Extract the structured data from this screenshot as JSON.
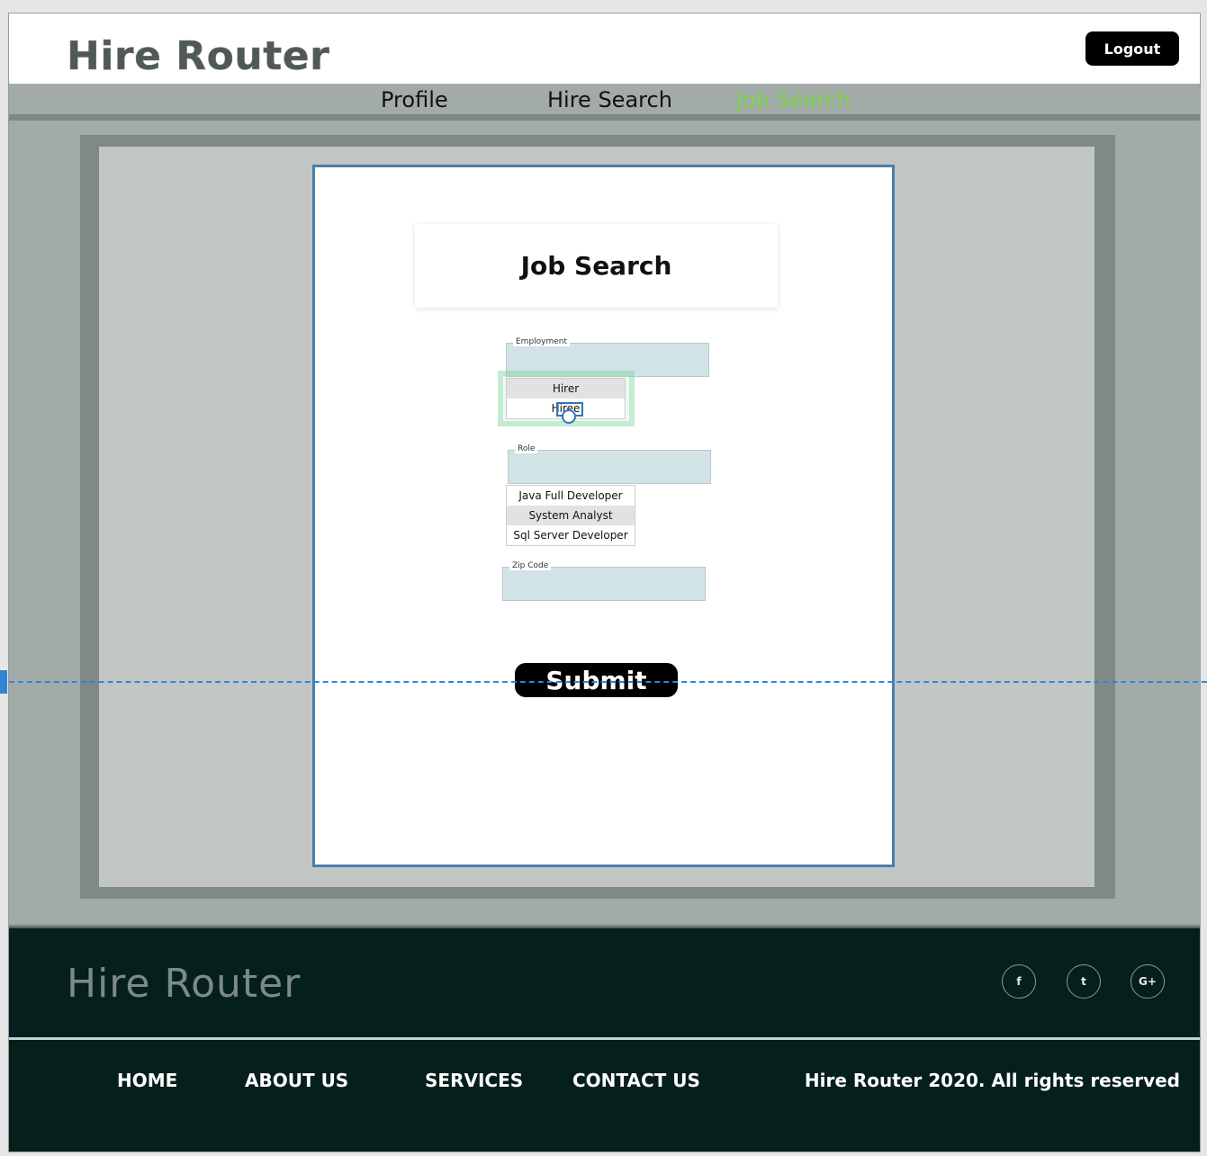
{
  "header": {
    "brand": "Hire Router",
    "logout_label": "Logout"
  },
  "nav": {
    "items": [
      {
        "label": "Profile",
        "active": false
      },
      {
        "label": "Hire Search",
        "active": false
      },
      {
        "label": "Job Search",
        "active": true
      }
    ]
  },
  "form": {
    "title": "Job Search",
    "employment": {
      "label": "Employment",
      "value": "",
      "options": [
        "Hirer",
        "Hiree"
      ],
      "highlighted": "Hirer"
    },
    "role": {
      "label": "Role",
      "value": "",
      "options": [
        "Java Full Developer",
        "System Analyst",
        "Sql Server Developer"
      ],
      "highlighted": "System Analyst"
    },
    "zip": {
      "label": "Zip Code",
      "value": ""
    },
    "submit_label": "Submit"
  },
  "footer": {
    "brand": "Hire Router",
    "social": [
      {
        "icon": "facebook-icon",
        "glyph": "f"
      },
      {
        "icon": "twitter-icon",
        "glyph": "t"
      },
      {
        "icon": "google-plus-icon",
        "glyph": "G+"
      }
    ],
    "links": [
      "HOME",
      "ABOUT US",
      "SERVICES",
      "CONTACT US"
    ],
    "copyright": "Hire Router 2020. All rights reserved"
  },
  "colors": {
    "accent_active_nav": "#7bd64a",
    "footer_bg": "#041f1c",
    "selection_blue": "#2f86d6"
  }
}
